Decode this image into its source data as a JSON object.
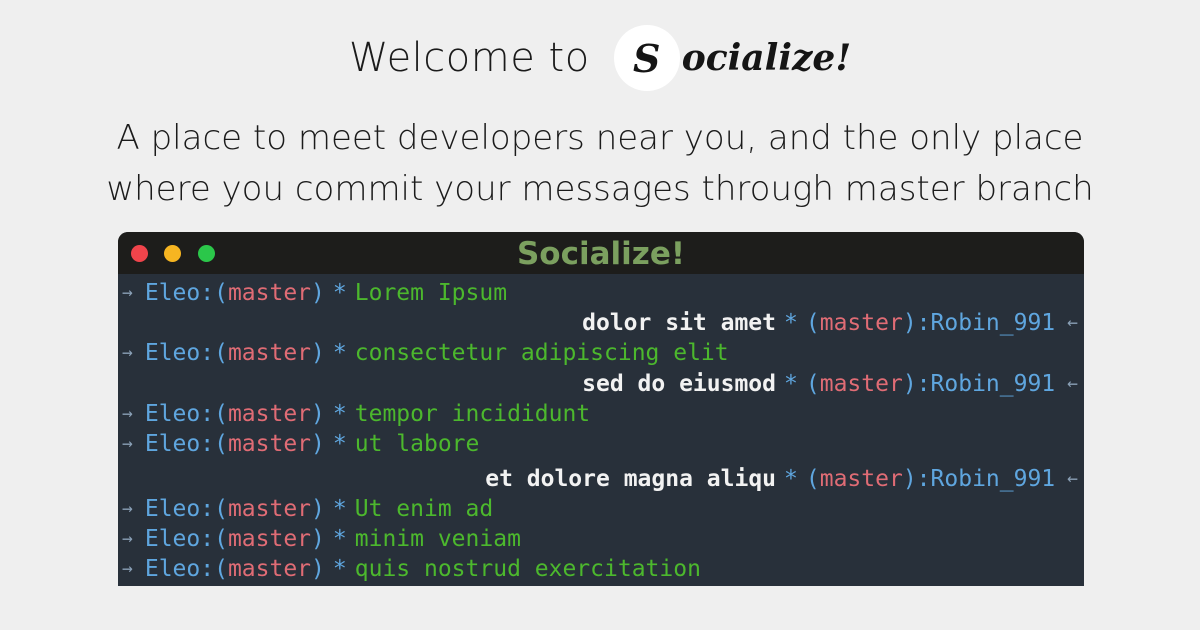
{
  "header": {
    "welcome": "Welcome to",
    "brand_initial": "S",
    "brand_rest": "ocialize!"
  },
  "tagline": {
    "line1": "A place to meet developers near you, and the only place",
    "line2": "where you commit your messages through master branch"
  },
  "terminal": {
    "title": "Socialize!",
    "arrow_out": "→",
    "arrow_in": "←",
    "messages": [
      {
        "dir": "out",
        "user": "Eleo",
        "branch": "master",
        "text": "Lorem Ipsum"
      },
      {
        "dir": "in",
        "user": "Robin_991",
        "branch": "master",
        "text": "dolor sit amet"
      },
      {
        "dir": "out",
        "user": "Eleo",
        "branch": "master",
        "text": "consectetur adipiscing elit"
      },
      {
        "dir": "in",
        "user": "Robin_991",
        "branch": "master",
        "text": "sed do eiusmod"
      },
      {
        "dir": "out",
        "user": "Eleo",
        "branch": "master",
        "text": "tempor incididunt"
      },
      {
        "dir": "out",
        "user": "Eleo",
        "branch": "master",
        "text": "ut labore"
      },
      {
        "dir": "in",
        "user": "Robin_991",
        "branch": "master",
        "text": "et dolore magna aliqu"
      },
      {
        "dir": "out",
        "user": "Eleo",
        "branch": "master",
        "text": "Ut enim ad"
      },
      {
        "dir": "out",
        "user": "Eleo",
        "branch": "master",
        "text": "minim veniam"
      },
      {
        "dir": "out",
        "user": "Eleo",
        "branch": "master",
        "text": "quis nostrud exercitation"
      }
    ]
  },
  "colors": {
    "background": "#efefef",
    "terminal_bg": "#28303a",
    "titlebar_bg": "#1d1d1b",
    "title_green": "#7ba05f",
    "user_blue": "#5fa6df",
    "branch_red": "#e06c75",
    "outgoing_green": "#4cb82d",
    "incoming_white": "#f2f2f2"
  }
}
